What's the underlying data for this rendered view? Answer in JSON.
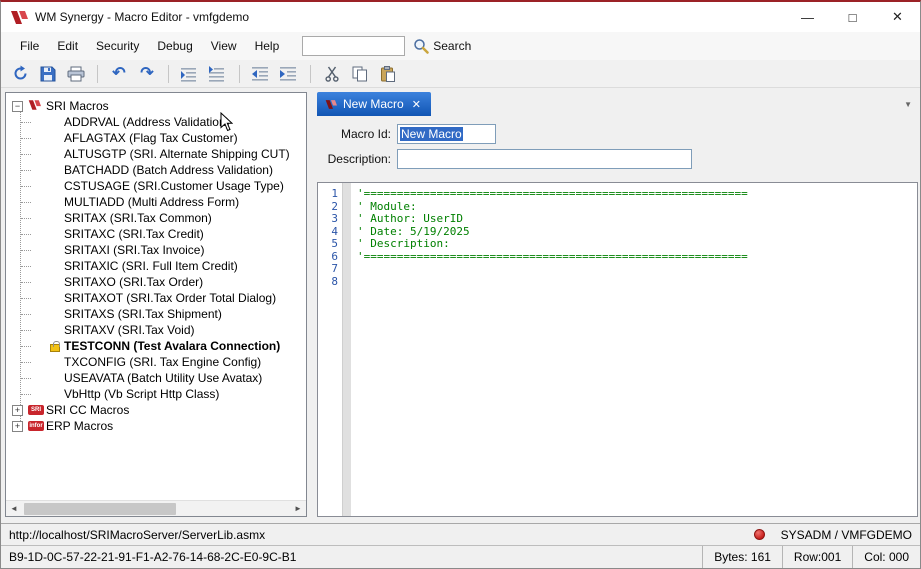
{
  "window": {
    "title": "WM Synergy - Macro Editor - vmfgdemo",
    "minimize_glyph": "—",
    "maximize_glyph": "□",
    "close_glyph": "✕"
  },
  "menu": {
    "items": [
      "File",
      "Edit",
      "Security",
      "Debug",
      "View",
      "Help"
    ],
    "search_value": "",
    "search_label": "Search"
  },
  "icons": {
    "expanded_glyph": "−",
    "collapsed_glyph": "+",
    "scroll_left": "◄",
    "scroll_right": "►",
    "tab_dropdown": "▼",
    "undo_glyph": "↶",
    "redo_glyph": "↷"
  },
  "tree": {
    "root_label": "SRI Macros",
    "items": [
      {
        "label": "ADDRVAL (Address Validation)"
      },
      {
        "label": "AFLAGTAX (Flag Tax Customer)"
      },
      {
        "label": "ALTUSGTP (SRI. Alternate Shipping CUT)"
      },
      {
        "label": "BATCHADD (Batch Address Validation)"
      },
      {
        "label": "CSTUSAGE (SRI.Customer Usage Type)"
      },
      {
        "label": "MULTIADD (Multi Address Form)"
      },
      {
        "label": "SRITAX (SRI.Tax Common)"
      },
      {
        "label": "SRITAXC (SRI.Tax Credit)"
      },
      {
        "label": "SRITAXI (SRI.Tax Invoice)"
      },
      {
        "label": "SRITAXIC (SRI. Full Item Credit)"
      },
      {
        "label": "SRITAXO (SRI.Tax Order)"
      },
      {
        "label": "SRITAXOT (SRI.Tax Order Total Dialog)"
      },
      {
        "label": "SRITAXS (SRI.Tax Shipment)"
      },
      {
        "label": "SRITAXV (SRI.Tax Void)"
      },
      {
        "label": "TESTCONN (Test Avalara Connection)",
        "bold": true,
        "lock": true
      },
      {
        "label": "TXCONFIG (SRI. Tax Engine Config)"
      },
      {
        "label": "USEAVATA (Batch Utility Use Avatax)"
      },
      {
        "label": "VbHttp (Vb Script Http Class)"
      }
    ],
    "collapsed_roots": [
      {
        "label": "SRI CC Macros",
        "icon_text": "SRI"
      },
      {
        "label": "ERP Macros",
        "icon_text": "infor"
      }
    ]
  },
  "tab": {
    "label": "New Macro",
    "close_glyph": "✕"
  },
  "form": {
    "macro_id_label": "Macro Id:",
    "macro_id_value": "New Macro",
    "description_label": "Description:",
    "description_value": ""
  },
  "editor": {
    "lines": [
      {
        "num": "1",
        "text": "'=========================================================="
      },
      {
        "num": "2",
        "text": "' Module:"
      },
      {
        "num": "3",
        "text": "' Author: UserID"
      },
      {
        "num": "4",
        "text": "' Date: 5/19/2025"
      },
      {
        "num": "5",
        "text": "' Description:"
      },
      {
        "num": "6",
        "text": "'=========================================================="
      },
      {
        "num": "7",
        "text": ""
      },
      {
        "num": "8",
        "text": ""
      }
    ]
  },
  "statusbar": {
    "url": "http://localhost/SRIMacroServer/ServerLib.asmx",
    "session": "SYSADM / VMFGDEMO",
    "token": "B9-1D-0C-57-22-21-91-F1-A2-76-14-68-2C-E0-9C-B1",
    "bytes": "Bytes: 161",
    "row": "Row:001",
    "col": "Col: 000"
  },
  "colors": {
    "tab_active": "#1155b4",
    "comment_green": "#008000",
    "selection_blue": "#316ac5",
    "accent_red": "#c8252c"
  }
}
